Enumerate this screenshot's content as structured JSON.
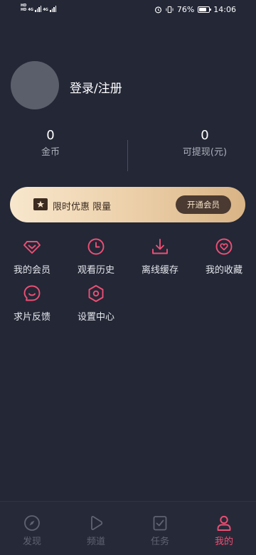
{
  "status_bar": {
    "hd_top": "HD",
    "hd_bottom": "HD",
    "network_1": "4G",
    "network_2": "4G",
    "battery_percent": "76%",
    "time": "14:06",
    "battery_level": 0.76
  },
  "profile": {
    "login_label": "登录/注册"
  },
  "stats": {
    "coins": {
      "value": "0",
      "label": "金币"
    },
    "withdrawable": {
      "value": "0",
      "label": "可提现(元)"
    }
  },
  "vip_banner": {
    "promo_text": "限时优惠 限量",
    "button_label": "开通会员"
  },
  "menu": [
    {
      "label": "我的会员",
      "icon": "diamond-icon"
    },
    {
      "label": "观看历史",
      "icon": "clock-icon"
    },
    {
      "label": "离线缓存",
      "icon": "download-icon"
    },
    {
      "label": "我的收藏",
      "icon": "heart-icon"
    },
    {
      "label": "求片反馈",
      "icon": "chat-bubble-icon"
    },
    {
      "label": "设置中心",
      "icon": "settings-hexagon-icon"
    }
  ],
  "bottom_nav": [
    {
      "label": "发现",
      "icon": "compass-icon",
      "active": false
    },
    {
      "label": "频道",
      "icon": "play-icon",
      "active": false
    },
    {
      "label": "任务",
      "icon": "task-check-icon",
      "active": false
    },
    {
      "label": "我的",
      "icon": "user-icon",
      "active": true
    }
  ],
  "colors": {
    "background": "#232736",
    "accent": "#ef4f74",
    "inactive": "#5f6372",
    "gold": "#ebcea7"
  }
}
